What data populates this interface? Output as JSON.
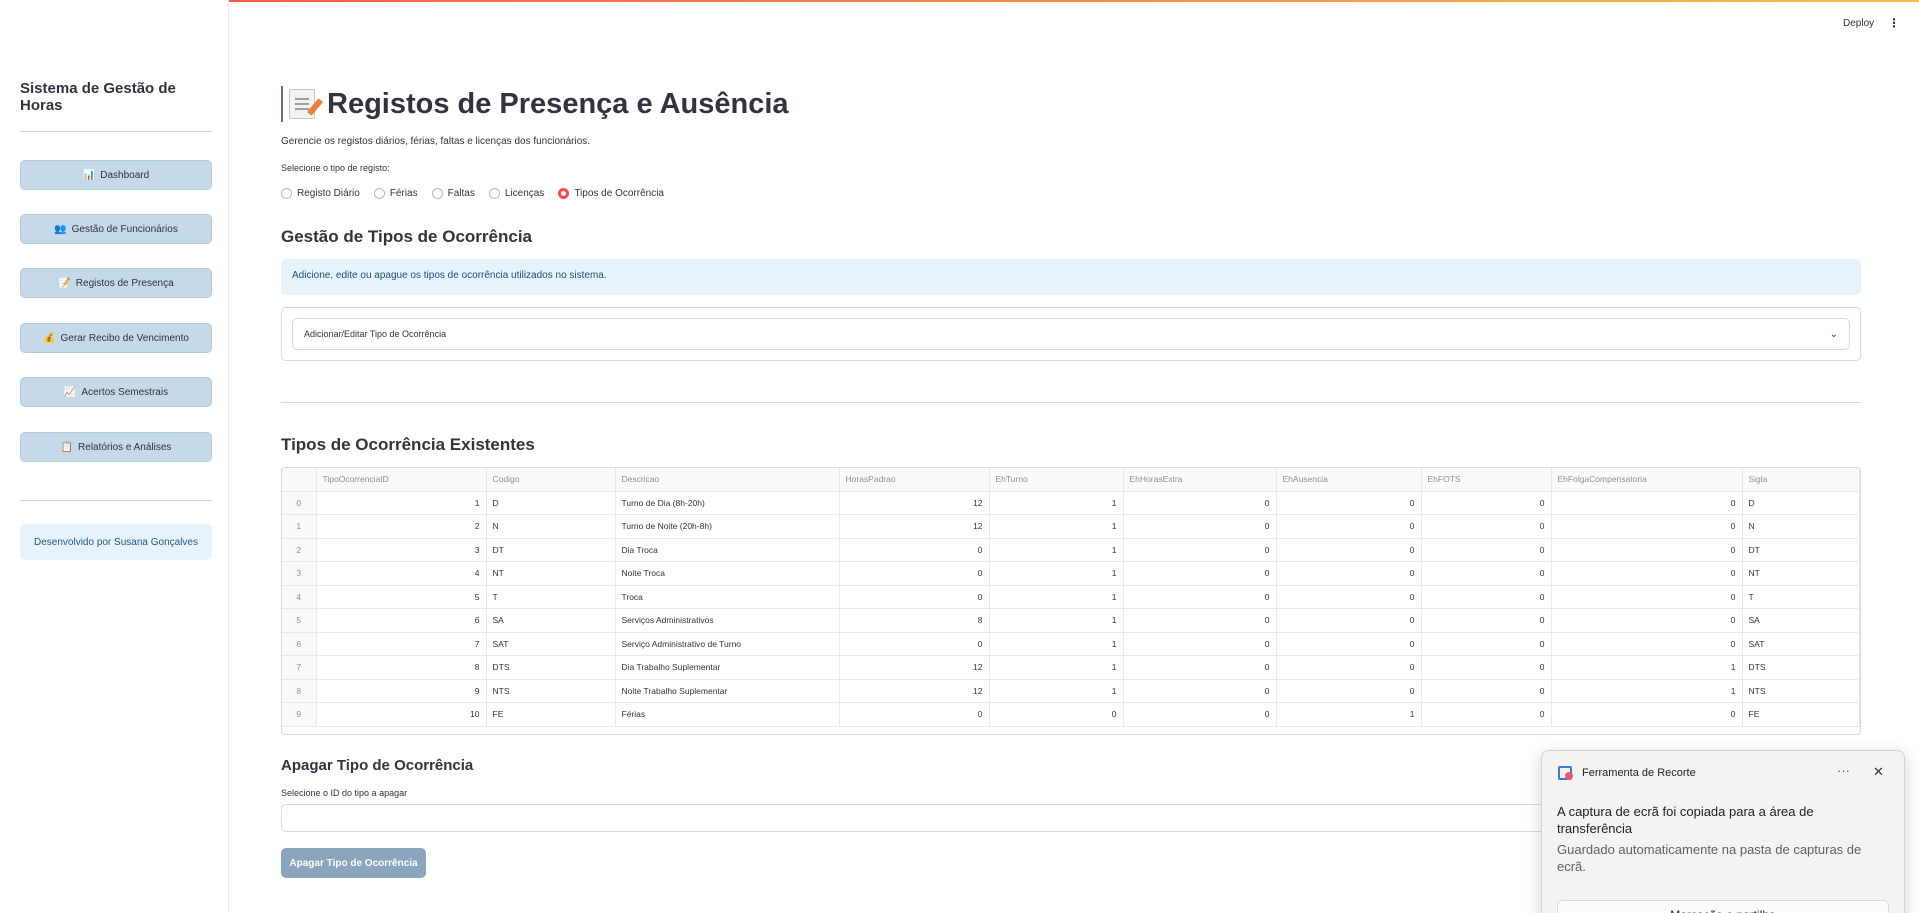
{
  "colors": {
    "accent": "#ff4b4b",
    "sidebar_button": "#c5d9e8",
    "info_bg": "#e8f2fc",
    "delete_button": "#8aa5bd"
  },
  "header": {
    "deploy_label": "Deploy",
    "menu_icon": "⋮"
  },
  "sidebar": {
    "title": "Sistema de Gestão de Horas",
    "items": [
      {
        "icon": "📊",
        "label": "Dashboard"
      },
      {
        "icon": "👥",
        "label": "Gestão de Funcionários"
      },
      {
        "icon": "📝",
        "label": "Registos de Presença"
      },
      {
        "icon": "💰",
        "label": "Gerar Recibo de Vencimento"
      },
      {
        "icon": "📈",
        "label": "Acertos Semestrais"
      },
      {
        "icon": "📋",
        "label": "Relatórios e Análises"
      }
    ],
    "developer": "Desenvolvido por Susana Gonçalves"
  },
  "main": {
    "title": "Registos de Presença e Ausência",
    "subtitle": "Gerencie os registos diários, férias, faltas e licenças dos funcionários.",
    "radio_label": "Selecione o tipo de registo:",
    "radio_options": [
      "Registo Diário",
      "Férias",
      "Faltas",
      "Licenças",
      "Tipos de Ocorrência"
    ],
    "radio_selected": "Tipos de Ocorrência",
    "section_title": "Gestão de Tipos de Ocorrência",
    "info": "Adicione, edite ou apague os tipos de ocorrência utilizados no sistema.",
    "expander_label": "Adicionar/Editar Tipo de Ocorrência",
    "existing_title": "Tipos de Ocorrência Existentes",
    "table": {
      "columns": [
        "",
        "TipoOcorrenciaID",
        "Codigo",
        "Descricao",
        "HorasPadrao",
        "EhTurno",
        "EhHorasExtra",
        "EhAusencia",
        "EhFOTS",
        "EhFolgaCompensatoria",
        "Sigla"
      ],
      "rows": [
        [
          "0",
          "1",
          "D",
          "Turno de Dia (8h-20h)",
          "12",
          "1",
          "0",
          "0",
          "0",
          "0",
          "D"
        ],
        [
          "1",
          "2",
          "N",
          "Turno de Noite (20h-8h)",
          "12",
          "1",
          "0",
          "0",
          "0",
          "0",
          "N"
        ],
        [
          "2",
          "3",
          "DT",
          "Dia Troca",
          "0",
          "1",
          "0",
          "0",
          "0",
          "0",
          "DT"
        ],
        [
          "3",
          "4",
          "NT",
          "Noite Troca",
          "0",
          "1",
          "0",
          "0",
          "0",
          "0",
          "NT"
        ],
        [
          "4",
          "5",
          "T",
          "Troca",
          "0",
          "1",
          "0",
          "0",
          "0",
          "0",
          "T"
        ],
        [
          "5",
          "6",
          "SA",
          "Serviços Administrativos",
          "8",
          "1",
          "0",
          "0",
          "0",
          "0",
          "SA"
        ],
        [
          "6",
          "7",
          "SAT",
          "Serviço Administrativo de Turno",
          "0",
          "1",
          "0",
          "0",
          "0",
          "0",
          "SAT"
        ],
        [
          "7",
          "8",
          "DTS",
          "Dia Trabalho Suplementar",
          "12",
          "1",
          "0",
          "0",
          "0",
          "1",
          "DTS"
        ],
        [
          "8",
          "9",
          "NTS",
          "Noite Trabalho Suplementar",
          "12",
          "1",
          "0",
          "0",
          "0",
          "1",
          "NTS"
        ],
        [
          "9",
          "10",
          "FE",
          "Férias",
          "0",
          "0",
          "0",
          "1",
          "0",
          "0",
          "FE"
        ]
      ]
    },
    "delete_title": "Apagar Tipo de Ocorrência",
    "delete_label": "Selecione o ID do tipo a apagar",
    "delete_button": "Apagar Tipo de Ocorrência"
  },
  "toast": {
    "app_name": "Ferramenta de Recorte",
    "more": "···",
    "close": "✕",
    "heading": "A captura de ecrã foi copiada para a área de transferência",
    "body": "Guardado automaticamente na pasta de capturas de ecrã.",
    "action": "Marcação e partilha"
  }
}
